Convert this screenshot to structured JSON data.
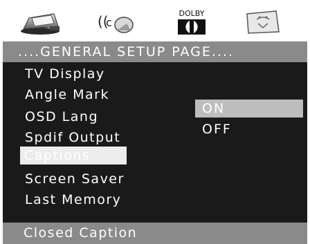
{
  "icons": [
    {
      "name": "general-setup-icon"
    },
    {
      "name": "audio-speaker-icon"
    },
    {
      "name": "dolby-logo-icon",
      "text": "DOLBY"
    },
    {
      "name": "preference-icon"
    }
  ],
  "header": {
    "title": "....GENERAL SETUP PAGE...."
  },
  "menu": {
    "items": [
      {
        "label": "TV Display"
      },
      {
        "label": "Angle Mark"
      },
      {
        "label": "OSD Lang"
      },
      {
        "label": "Spdif Output"
      },
      {
        "label": "Captions"
      },
      {
        "label": "Screen Saver"
      },
      {
        "label": "Last Memory"
      }
    ],
    "selected_index": 4
  },
  "submenu": {
    "options": [
      {
        "label": "ON"
      },
      {
        "label": "OFF"
      }
    ],
    "selected_index": 0
  },
  "footer": {
    "text": "Closed Caption"
  },
  "colors": {
    "header_bg": "#8a8a8a",
    "main_bg": "#1a1a1a",
    "highlight": "#ececec",
    "sub_highlight": "#bdbdbd"
  }
}
